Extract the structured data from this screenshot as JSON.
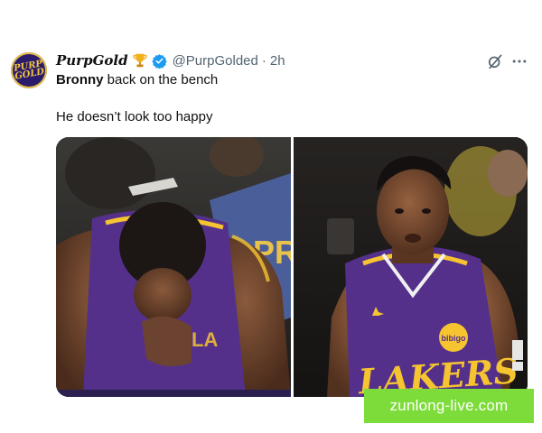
{
  "tweet": {
    "avatar_text": "PURP GOLD",
    "display_name": "PurpGold",
    "handle": "@PurpGolded",
    "separator": "·",
    "time": "2h",
    "text_line1_bold": "Bronny",
    "text_line1_rest": " back on the bench",
    "text_line2": "He doesn’t look too happy",
    "icons": [
      "trophy-icon",
      "verified-icon",
      "grok-icon",
      "more-icon"
    ],
    "colors": {
      "verified": "#1d9bf0",
      "handle_gray": "#536471",
      "jersey_purple": "#55308b",
      "jersey_gold": "#f5c430"
    }
  },
  "media": {
    "left_image_text": "PR",
    "right_image_jersey_text": "LAKERS",
    "right_image_patch_text": "bibigo"
  },
  "watermark": {
    "text": "zunlong-live.com",
    "color": "#7ddc3a"
  }
}
